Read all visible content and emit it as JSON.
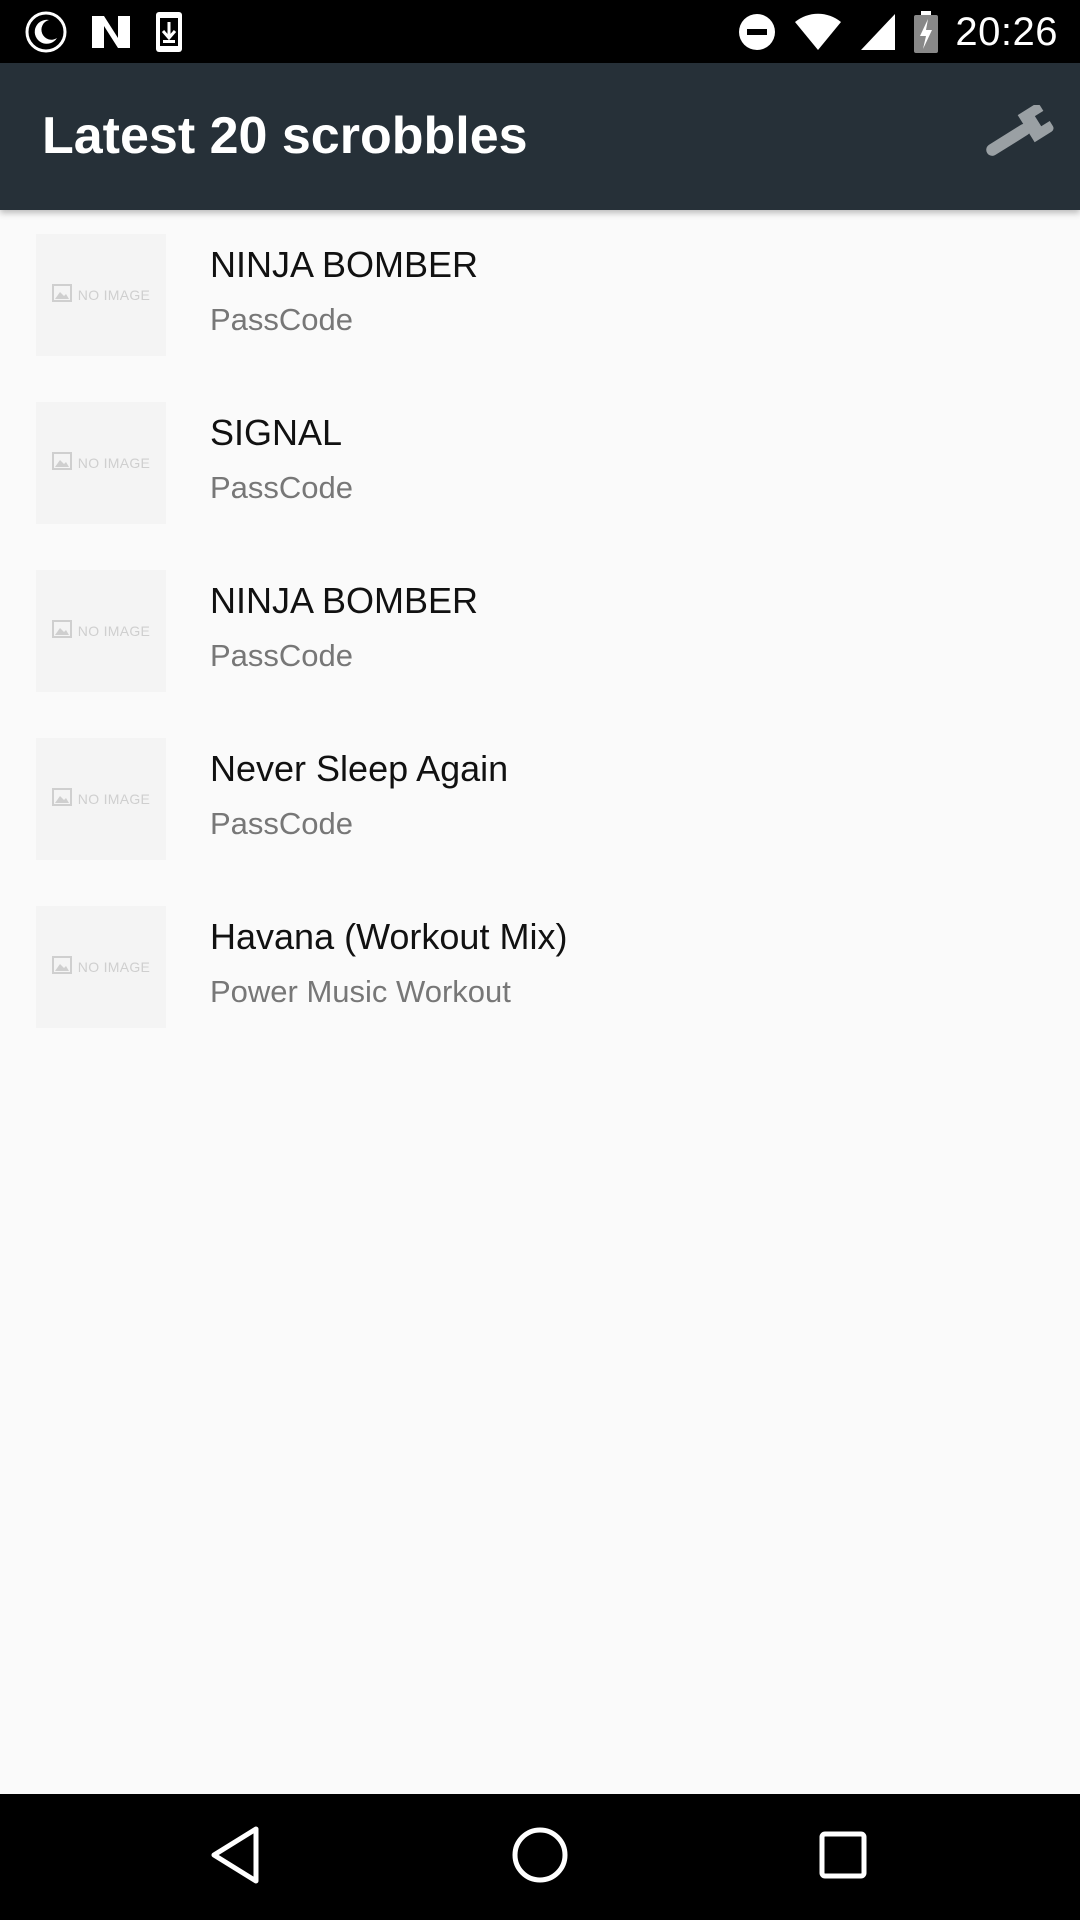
{
  "status_bar": {
    "time": "20:26",
    "icons_left": [
      "night-mode-icon",
      "n-icon",
      "download-icon"
    ],
    "icons_right": [
      "dnd-icon",
      "wifi-icon",
      "signal-icon",
      "battery-charging-icon"
    ]
  },
  "app_bar": {
    "title": "Latest 20 scrobbles",
    "action_icon": "wrench-icon",
    "background": "#263038"
  },
  "thumbnail": {
    "placeholder": "NO IMAGE"
  },
  "tracks": [
    {
      "title": "NINJA BOMBER",
      "artist": "PassCode"
    },
    {
      "title": "SIGNAL",
      "artist": "PassCode"
    },
    {
      "title": "NINJA BOMBER",
      "artist": "PassCode"
    },
    {
      "title": "Never Sleep Again",
      "artist": "PassCode"
    },
    {
      "title": "Havana (Workout Mix)",
      "artist": "Power Music Workout"
    }
  ],
  "nav_bar": {
    "icons": [
      "back-icon",
      "home-icon",
      "recents-icon"
    ]
  }
}
